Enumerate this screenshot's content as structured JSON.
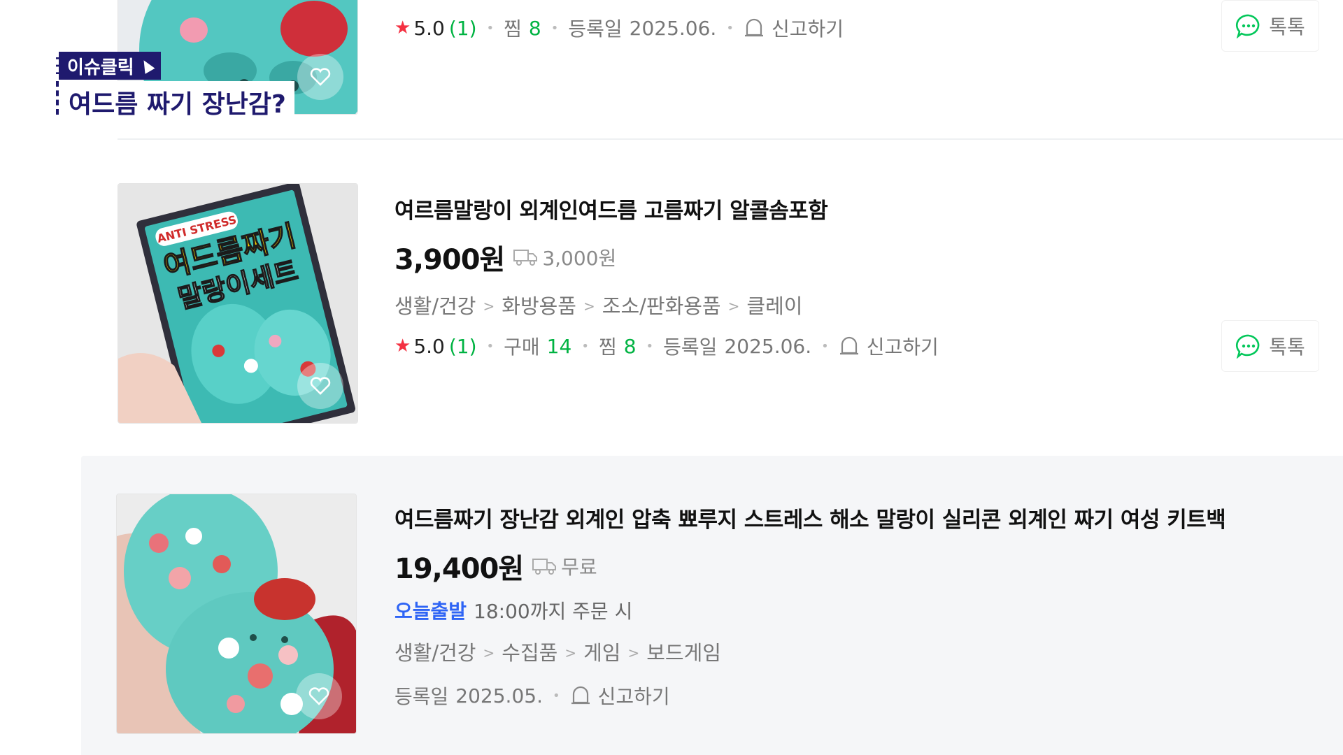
{
  "overlay": {
    "tag": "이슈클릭",
    "headline": "여드름 짜기 장난감?"
  },
  "items": [
    {
      "rating": "5.0",
      "review_count": "(1)",
      "wish_label": "찜",
      "wish_count": "8",
      "reg_label": "등록일",
      "reg_date": "2025.06.",
      "report_label": "신고하기",
      "talk_label": "톡톡"
    },
    {
      "title": "여르름말랑이 외계인여드름 고름짜기 알콜솜포함",
      "price": "3,900원",
      "shipping": "3,000원",
      "category": [
        "생활/건강",
        "화방용품",
        "조소/판화용품",
        "클레이"
      ],
      "rating": "5.0",
      "review_count": "(1)",
      "buy_label": "구매",
      "buy_count": "14",
      "wish_label": "찜",
      "wish_count": "8",
      "reg_label": "등록일",
      "reg_date": "2025.06.",
      "report_label": "신고하기",
      "talk_label": "톡톡",
      "thumb_text": {
        "top": "ANTI STRESS",
        "main": "여드름짜기",
        "sub": "말랑이세트"
      }
    },
    {
      "title": "여드름짜기 장난감 외계인 압축 뾰루지 스트레스 해소 말랑이 실리콘 외계인 짜기 여성 키트백",
      "price": "19,400원",
      "shipping": "무료",
      "dispatch_badge": "오늘출발",
      "dispatch_text": "18:00까지 주문 시",
      "category": [
        "생활/건강",
        "수집품",
        "게임",
        "보드게임"
      ],
      "reg_label": "등록일",
      "reg_date": "2025.05.",
      "report_label": "신고하기"
    }
  ],
  "icons": {
    "heart": "heart-icon",
    "truck": "truck-icon",
    "bell": "report-bell-icon",
    "talk": "talk-bubble-icon",
    "star": "star-icon"
  },
  "colors": {
    "price_text": "#111111",
    "green_count": "#00b342",
    "star": "#f43142",
    "dispatch_blue": "#2e64f5",
    "overlay_navy": "#1f1a6e",
    "talk_green": "#03c75a"
  }
}
